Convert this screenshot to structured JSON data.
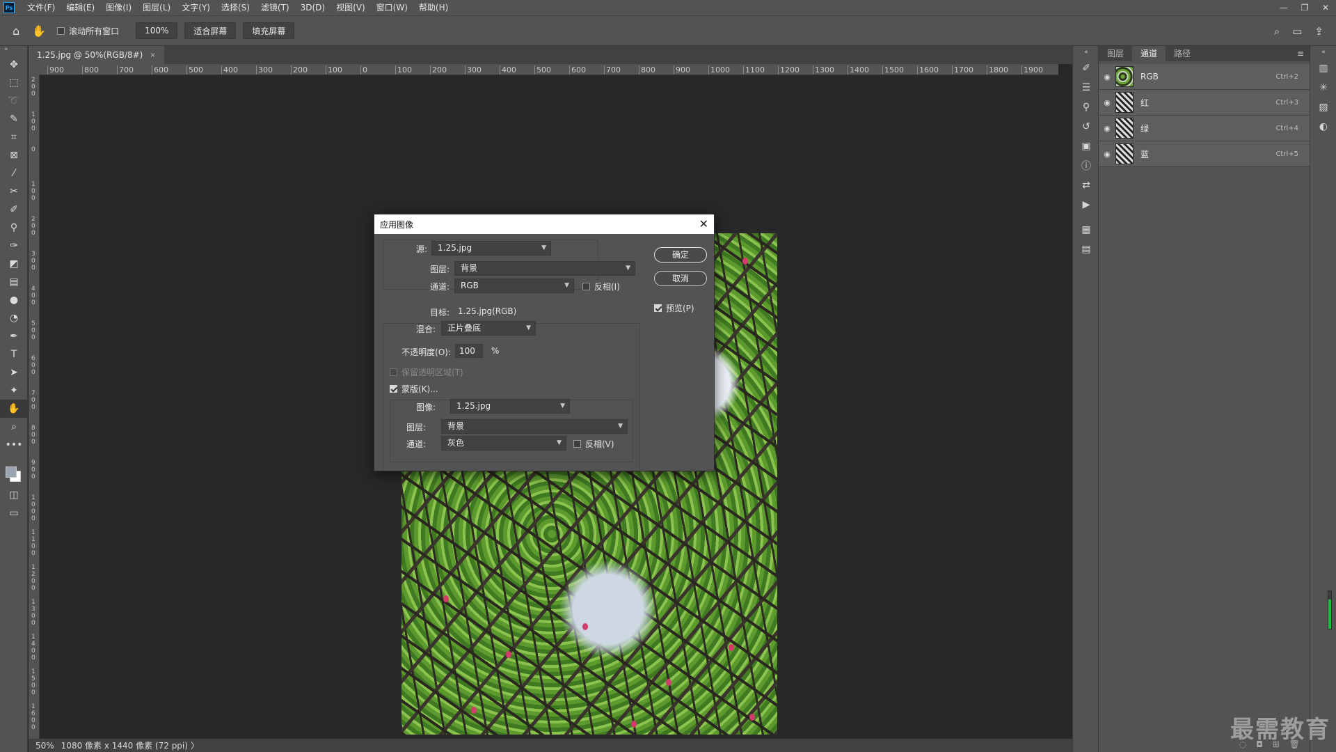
{
  "menu": [
    "文件(F)",
    "编辑(E)",
    "图像(I)",
    "图层(L)",
    "文字(Y)",
    "选择(S)",
    "滤镜(T)",
    "3D(D)",
    "视图(V)",
    "窗口(W)",
    "帮助(H)"
  ],
  "app_logo": "Ps",
  "window_controls": {
    "minimize": "—",
    "restore": "❐",
    "close": "✕"
  },
  "options": {
    "scroll_all_windows": "滚动所有窗口",
    "zoom_100": "100%",
    "fit_screen": "适合屏幕",
    "fill_screen": "填充屏幕"
  },
  "document": {
    "tab_title": "1.25.jpg @ 50%(RGB/8#)",
    "tab_close": "×",
    "ruler_h": [
      "900",
      "800",
      "700",
      "600",
      "500",
      "400",
      "300",
      "200",
      "100",
      "0",
      "100",
      "200",
      "300",
      "400",
      "500",
      "600",
      "700",
      "800",
      "900",
      "1000",
      "1100",
      "1200",
      "1300",
      "1400",
      "1500",
      "1600",
      "1700",
      "1800",
      "1900"
    ],
    "ruler_v": [
      "200",
      "100",
      "0",
      "100",
      "200",
      "300",
      "400",
      "500",
      "600",
      "700",
      "800",
      "900",
      "1000",
      "1100",
      "1200",
      "1300",
      "1400",
      "1500",
      "1600"
    ]
  },
  "status": {
    "zoom": "50%",
    "info": "1080 像素 x 1440 像素 (72 ppi)",
    "arrow": "〉"
  },
  "panel": {
    "tabs": [
      "图层",
      "通道",
      "路径"
    ],
    "active_tab": 1,
    "menu_icon": "≡",
    "channels": [
      {
        "name": "RGB",
        "shortcut": "Ctrl+2"
      },
      {
        "name": "红",
        "shortcut": "Ctrl+3"
      },
      {
        "name": "绿",
        "shortcut": "Ctrl+4"
      },
      {
        "name": "蓝",
        "shortcut": "Ctrl+5"
      }
    ]
  },
  "watermark": "最需教育",
  "dialog": {
    "title": "应用图像",
    "close": "✕",
    "source_label": "源:",
    "source_value": "1.25.jpg",
    "layer_label": "图层:",
    "layer_value": "背景",
    "channel_label": "通道:",
    "channel_value": "RGB",
    "invert_label": "反相(I)",
    "target_label": "目标:",
    "target_value": "1.25.jpg(RGB)",
    "blend_label": "混合:",
    "blend_value": "正片叠底",
    "opacity_label": "不透明度(O):",
    "opacity_value": "100",
    "opacity_unit": "%",
    "preserve_label": "保留透明区域(T)",
    "mask_label": "蒙版(K)...",
    "mask_image_label": "图像:",
    "mask_image_value": "1.25.jpg",
    "mask_layer_label": "图层:",
    "mask_layer_value": "背景",
    "mask_channel_label": "通道:",
    "mask_channel_value": "灰色",
    "mask_invert_label": "反相(V)",
    "ok": "确定",
    "cancel": "取消",
    "preview_label": "预览(P)"
  }
}
